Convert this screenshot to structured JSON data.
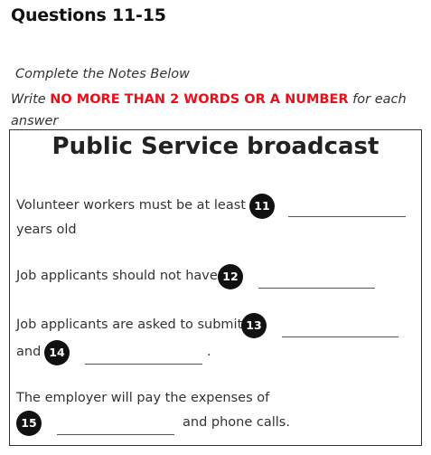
{
  "section_title": "Questions 11-15",
  "instructions": {
    "line1": "Complete the Notes Below",
    "line2_prefix": "Write ",
    "line2_highlight": "NO MORE THAN 2 WORDS OR A NUMBER",
    "line2_suffix": " for each answer"
  },
  "notes": {
    "title": "Public Service broadcast",
    "q11": {
      "number": "11",
      "text_before": "Volunteer  workers must be at least",
      "text_after": "years old"
    },
    "q12": {
      "number": "12",
      "text_before": "Job applicants should not have"
    },
    "q13": {
      "number": "13",
      "text_before": "Job applicants are asked to submit"
    },
    "q14": {
      "number": "14",
      "text_before": "and",
      "text_after": "."
    },
    "q15": {
      "number": "15",
      "text_before": "The employer will pay the expenses of",
      "text_after": "and phone calls."
    }
  },
  "colors": {
    "highlight": "#e8101a",
    "badge": "#111111"
  }
}
